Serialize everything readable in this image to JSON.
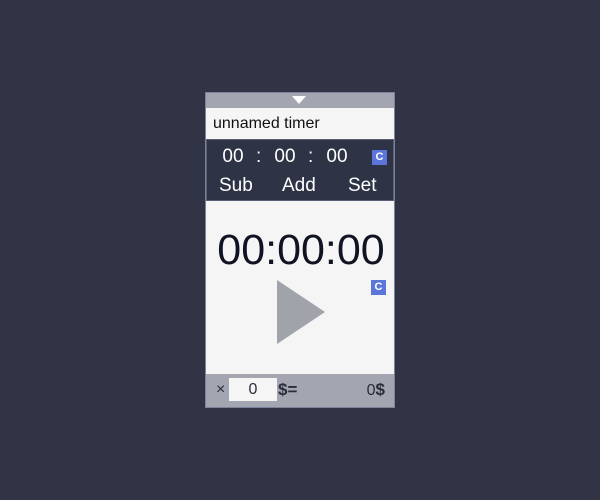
{
  "timer": {
    "name": "unnamed timer",
    "setter": {
      "hours": "00",
      "minutes": "00",
      "seconds": "00",
      "separator": ":",
      "clear_label": "C",
      "sub_label": "Sub",
      "add_label": "Add",
      "set_label": "Set"
    },
    "display": {
      "time": "00:00:00",
      "clear_label": "C"
    },
    "footer": {
      "multiply_symbol": "×",
      "rate_value": "0",
      "rate_unit": "$=",
      "earned_value": "0",
      "earned_unit": "$"
    }
  },
  "colors": {
    "background": "#313445",
    "panel": "#f5f5f5",
    "setter_bg": "#2f3346",
    "bar": "#a3a6b1",
    "accent": "#5c75d9",
    "play": "#a1a3ab"
  },
  "icons": {
    "collapse": "triangle-down-icon",
    "play": "play-icon"
  }
}
